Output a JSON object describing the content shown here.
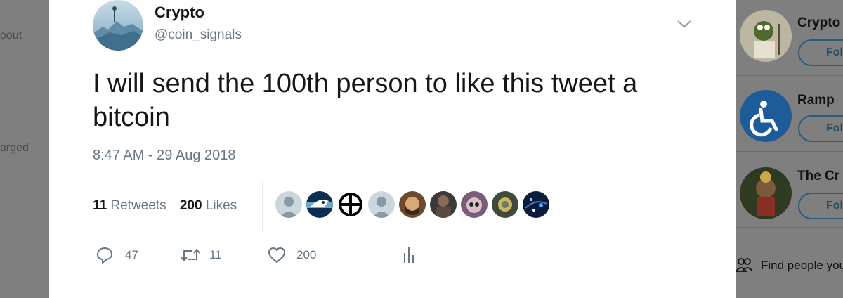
{
  "background_left": {
    "fragments": [
      "oout",
      "arged"
    ]
  },
  "tweet": {
    "author_name": "Crypto",
    "author_handle": "@coin_signals",
    "text": "I will send the 100th person to like this tweet a bitcoin",
    "timestamp": "8:47 AM - 29 Aug 2018",
    "retweets_count": "11",
    "retweets_label": "Retweets",
    "likes_count": "200",
    "likes_label": "Likes",
    "actions": {
      "reply_count": "47",
      "retweet_count": "11",
      "like_count": "200"
    }
  },
  "who_to_follow": {
    "items": [
      {
        "name": "Crypto",
        "follow_label": "Follow"
      },
      {
        "name": "Ramp",
        "follow_label": "Follow"
      },
      {
        "name": "The Cr",
        "follow_label": "Follow"
      }
    ],
    "find_people": "Find people you know"
  },
  "colors": {
    "text_primary": "#14171a",
    "text_secondary": "#657786",
    "divider": "#e6ecf0",
    "overlay": "#7f7f7f"
  }
}
